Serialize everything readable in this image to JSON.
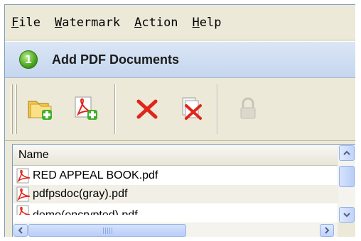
{
  "menu": {
    "items": [
      {
        "accel": "F",
        "rest": "ile"
      },
      {
        "accel": "W",
        "rest": "atermark"
      },
      {
        "accel": "A",
        "rest": "ction"
      },
      {
        "accel": "H",
        "rest": "elp"
      }
    ]
  },
  "step": {
    "number": "1",
    "title": "Add PDF Documents"
  },
  "toolbar": {
    "buttons": [
      {
        "icon": "add-folder-icon",
        "enabled": true
      },
      {
        "icon": "add-pdf-icon",
        "enabled": true
      },
      {
        "icon": "delete-icon",
        "enabled": true
      },
      {
        "icon": "clear-all-icon",
        "enabled": true
      },
      {
        "icon": "lock-icon",
        "enabled": false
      }
    ]
  },
  "file_list": {
    "column_header": "Name",
    "files": [
      "RED APPEAL BOOK.pdf",
      "pdfpsdoc(gray).pdf",
      "demo(encrypted).pdf"
    ]
  },
  "colors": {
    "accent_red": "#e0251b",
    "step_green": "#4aa51d",
    "header_blue": "#c5d6ee"
  }
}
